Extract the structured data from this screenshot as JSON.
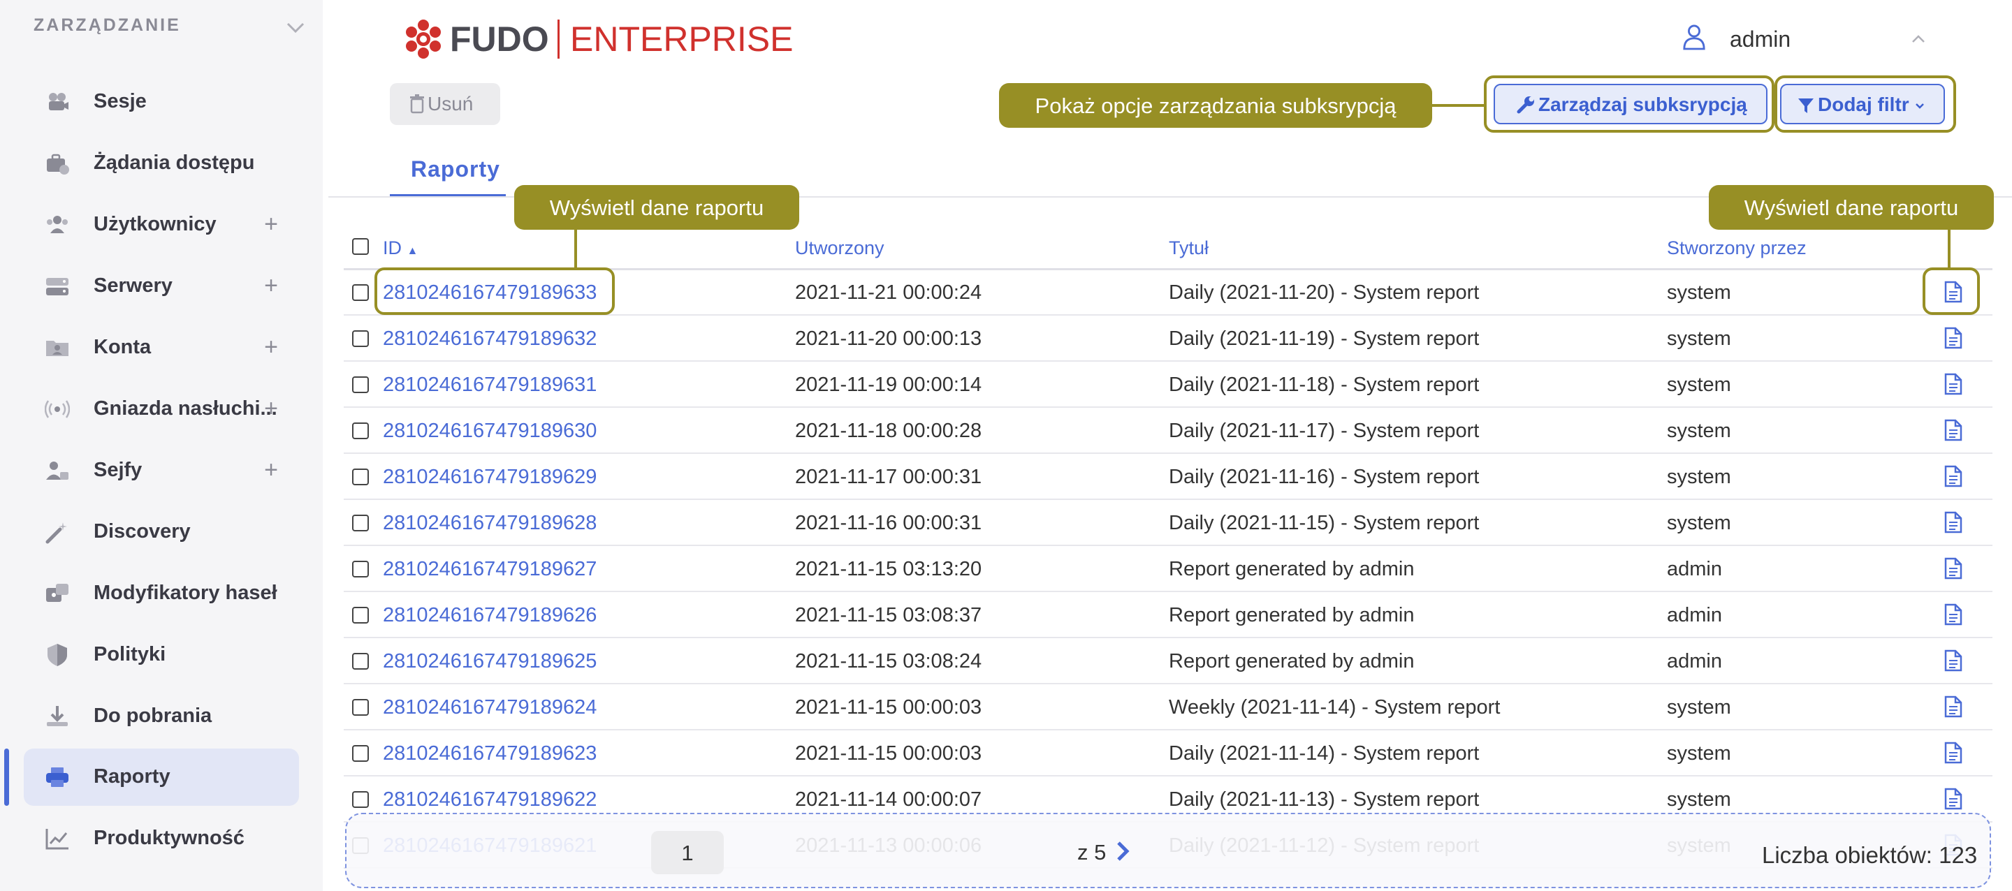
{
  "sidebar": {
    "section_label": "ZARZĄDZANIE",
    "items": [
      {
        "label": "Sesje",
        "icon": "camera-icon",
        "plus": ""
      },
      {
        "label": "Żądania dostępu",
        "icon": "briefcase-icon",
        "plus": ""
      },
      {
        "label": "Użytkownicy",
        "icon": "users-icon",
        "plus": "+"
      },
      {
        "label": "Serwery",
        "icon": "server-icon",
        "plus": "+"
      },
      {
        "label": "Konta",
        "icon": "account-folder-icon",
        "plus": "+"
      },
      {
        "label": "Gniazda nasłuchi...",
        "icon": "broadcast-icon",
        "plus": "+"
      },
      {
        "label": "Sejfy",
        "icon": "safe-user-icon",
        "plus": "+"
      },
      {
        "label": "Discovery",
        "icon": "magic-wand-icon",
        "plus": ""
      },
      {
        "label": "Modyfikatory haseł",
        "icon": "password-modifier-icon",
        "plus": ""
      },
      {
        "label": "Polityki",
        "icon": "shield-icon",
        "plus": ""
      },
      {
        "label": "Do pobrania",
        "icon": "download-icon",
        "plus": ""
      },
      {
        "label": "Raporty",
        "icon": "printer-icon",
        "plus": ""
      },
      {
        "label": "Produktywność",
        "icon": "chart-line-icon",
        "plus": ""
      }
    ],
    "active_index": 11
  },
  "header": {
    "logo_left": "FUDO",
    "logo_right": "ENTERPRISE",
    "user_name": "admin"
  },
  "toolbar": {
    "delete_label": "Usuń",
    "manage_label": "Zarządzaj subksrypcją",
    "filter_label": "Dodaj filtr"
  },
  "tabs": [
    {
      "label": "Raporty"
    }
  ],
  "table": {
    "columns": {
      "id": "ID",
      "created": "Utworzony",
      "title": "Tytuł",
      "created_by": "Stworzony przez"
    },
    "rows": [
      {
        "id": "2810246167479189633",
        "created": "2021-11-21 00:00:24",
        "title": "Daily (2021-11-20) - System report",
        "by": "system"
      },
      {
        "id": "2810246167479189632",
        "created": "2021-11-20 00:00:13",
        "title": "Daily (2021-11-19) - System report",
        "by": "system"
      },
      {
        "id": "2810246167479189631",
        "created": "2021-11-19 00:00:14",
        "title": "Daily (2021-11-18) - System report",
        "by": "system"
      },
      {
        "id": "2810246167479189630",
        "created": "2021-11-18 00:00:28",
        "title": "Daily (2021-11-17) - System report",
        "by": "system"
      },
      {
        "id": "2810246167479189629",
        "created": "2021-11-17 00:00:31",
        "title": "Daily (2021-11-16) - System report",
        "by": "system"
      },
      {
        "id": "2810246167479189628",
        "created": "2021-11-16 00:00:31",
        "title": "Daily (2021-11-15) - System report",
        "by": "system"
      },
      {
        "id": "2810246167479189627",
        "created": "2021-11-15 03:13:20",
        "title": "Report generated by admin",
        "by": "admin"
      },
      {
        "id": "2810246167479189626",
        "created": "2021-11-15 03:08:37",
        "title": "Report generated by admin",
        "by": "admin"
      },
      {
        "id": "2810246167479189625",
        "created": "2021-11-15 03:08:24",
        "title": "Report generated by admin",
        "by": "admin"
      },
      {
        "id": "2810246167479189624",
        "created": "2021-11-15 00:00:03",
        "title": "Weekly (2021-11-14) - System report",
        "by": "system"
      },
      {
        "id": "2810246167479189623",
        "created": "2021-11-15 00:00:03",
        "title": "Daily (2021-11-14) - System report",
        "by": "system"
      },
      {
        "id": "2810246167479189622",
        "created": "2021-11-14 00:00:07",
        "title": "Daily (2021-11-13) - System report",
        "by": "system"
      },
      {
        "id": "2810246167479189621",
        "created": "2021-11-13 00:00:06",
        "title": "Daily (2021-11-12) - System report",
        "by": "system"
      }
    ]
  },
  "callouts": {
    "manage": "Pokaż opcje zarządzania subksrypcją",
    "view_id": "Wyświetl dane raportu",
    "view_doc": "Wyświetl dane raportu"
  },
  "pagination": {
    "current_page": "1",
    "of_label": "z 5",
    "count_label": "Liczba obiektów: 123"
  },
  "colors": {
    "accent": "#4a6bd6",
    "callout": "#978f25",
    "logo_red": "#d0312d"
  }
}
